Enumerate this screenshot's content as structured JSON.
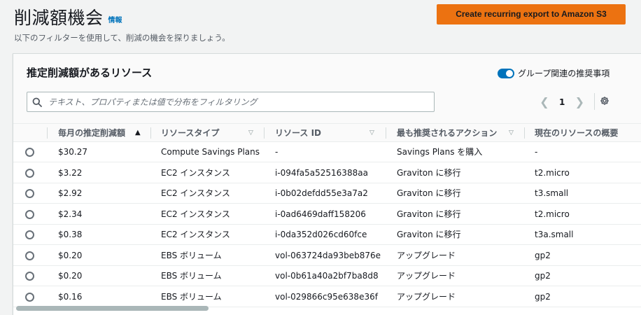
{
  "page": {
    "title": "削減額機会",
    "info_link": "情報",
    "description": "以下のフィルターを使用して、削減の機会を探りましょう。",
    "export_button": "Create recurring export to Amazon S3"
  },
  "panel": {
    "title": "推定削減額があるリソース",
    "toggle_label": "グループ関連の推奨事項",
    "toggle_on": true,
    "filter_placeholder": "テキスト、プロパティまたは値で分布をフィルタリング",
    "current_page": "1"
  },
  "columns": [
    "毎月の推定削減額",
    "リソースタイプ",
    "リソース ID",
    "最も推奨されるアクション",
    "現在のリソースの概要"
  ],
  "rows": [
    {
      "savings": "$30.27",
      "type": "Compute Savings Plans",
      "id": "-",
      "action": "Savings Plans を購入",
      "summary": "-"
    },
    {
      "savings": "$3.22",
      "type": "EC2 インスタンス",
      "id": "i-094fa5a52516388aa",
      "action": "Graviton に移行",
      "summary": "t2.micro"
    },
    {
      "savings": "$2.92",
      "type": "EC2 インスタンス",
      "id": "i-0b02defdd55e3a7a2",
      "action": "Graviton に移行",
      "summary": "t3.small"
    },
    {
      "savings": "$2.34",
      "type": "EC2 インスタンス",
      "id": "i-0ad6469daff158206",
      "action": "Graviton に移行",
      "summary": "t2.micro"
    },
    {
      "savings": "$0.38",
      "type": "EC2 インスタンス",
      "id": "i-0da352d026cd60fce",
      "action": "Graviton に移行",
      "summary": "t3a.small"
    },
    {
      "savings": "$0.20",
      "type": "EBS ボリューム",
      "id": "vol-063724da93beb876e",
      "action": "アップグレード",
      "summary": "gp2"
    },
    {
      "savings": "$0.20",
      "type": "EBS ボリューム",
      "id": "vol-0b61a40a2bf7ba8d8",
      "action": "アップグレード",
      "summary": "gp2"
    },
    {
      "savings": "$0.16",
      "type": "EBS ボリューム",
      "id": "vol-029866c95e638e36f",
      "action": "アップグレード",
      "summary": "gp2"
    }
  ],
  "colors": {
    "accent_orange": "#ec7211",
    "link_blue": "#0073bb"
  }
}
